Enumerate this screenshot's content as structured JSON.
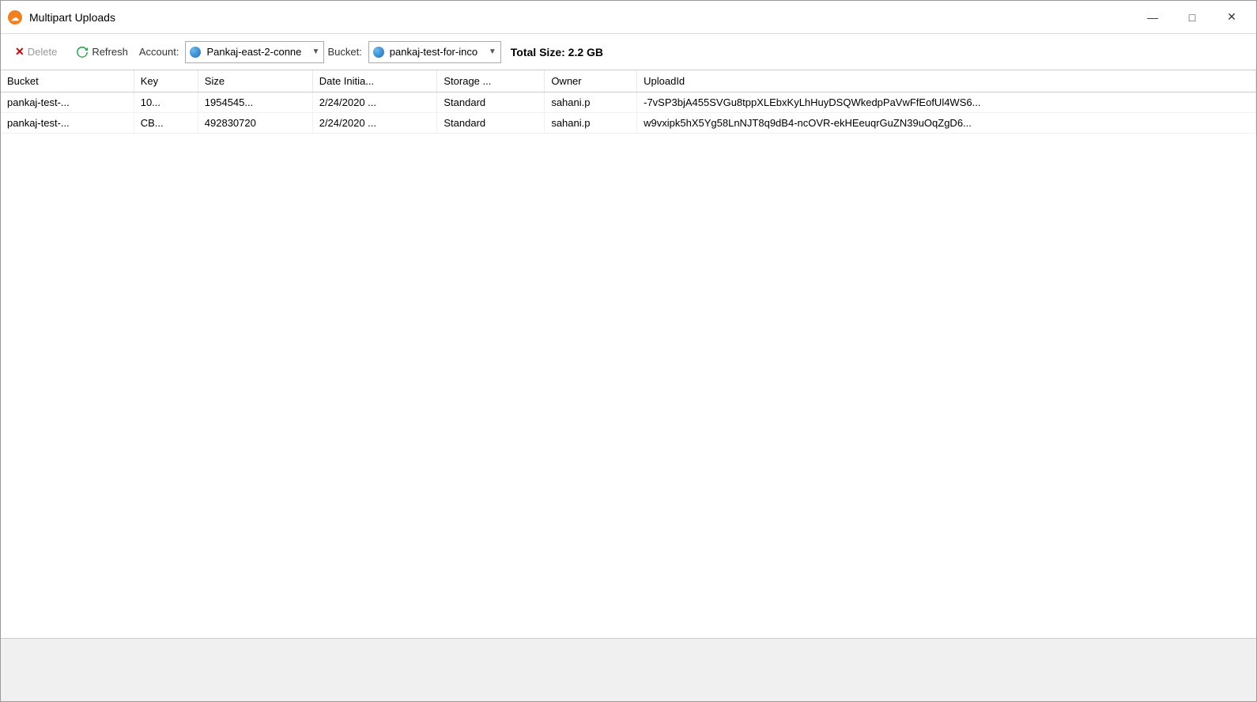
{
  "window": {
    "title": "Multipart Uploads",
    "min_btn": "—",
    "max_btn": "□",
    "close_btn": "✕"
  },
  "toolbar": {
    "delete_label": "Delete",
    "refresh_label": "Refresh",
    "account_label": "Account:",
    "account_value": "Pankaj-east-2-conne",
    "bucket_label": "Bucket:",
    "bucket_value": "pankaj-test-for-inco",
    "total_size_label": "Total Size: 2.2 GB"
  },
  "table": {
    "columns": [
      "Bucket",
      "Key",
      "Size",
      "Date Initia...",
      "Storage ...",
      "Owner",
      "UploadId"
    ],
    "rows": [
      {
        "bucket": "pankaj-test-...",
        "key": "10...",
        "size": "1954545...",
        "date": "2/24/2020 ...",
        "storage": "Standard",
        "owner": "sahani.p",
        "uploadId": "-7vSP3bjA455SVGu8tppXLEbxKyLhHuyDSQWkedpPaVwFfEofUl4WS6..."
      },
      {
        "bucket": "pankaj-test-...",
        "key": "CB...",
        "size": "492830720",
        "date": "2/24/2020 ...",
        "storage": "Standard",
        "owner": "sahani.p",
        "uploadId": "w9vxipk5hX5Yg58LnNJT8q9dB4-ncOVR-ekHEeuqrGuZN39uOqZgD6..."
      }
    ]
  }
}
